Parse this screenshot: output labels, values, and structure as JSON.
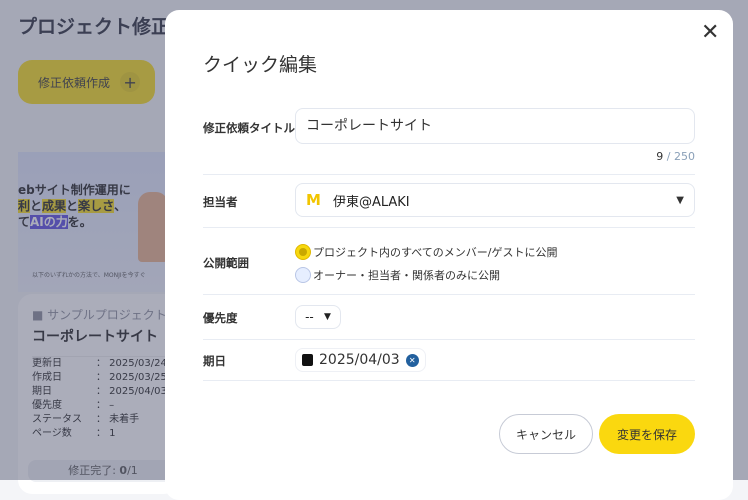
{
  "background": {
    "page_title": "プロジェクト修正",
    "create_button": "修正依頼作成",
    "thumbnail": {
      "line1": "ebサイト制作運用に",
      "line2a": "利",
      "line2b": "と",
      "line2c": "成果",
      "line2d": "と",
      "line2e": "楽しさ",
      "line2f": "、",
      "line3a": "て",
      "line3b": "AIの力",
      "line3c": "を。",
      "footer": "以下のいずれかの方法で、MONJIを今すぐ"
    },
    "card": {
      "project": "サンプルプロジェクト",
      "name": "コーポレートサイト",
      "rows": [
        {
          "k": "更新日",
          "v": "： 2025/03/24"
        },
        {
          "k": "作成日",
          "v": "： 2025/03/25"
        },
        {
          "k": "期日",
          "v": "： 2025/04/03"
        },
        {
          "k": "優先度",
          "v": "： –"
        },
        {
          "k": "ステータス",
          "v": "： 未着手"
        },
        {
          "k": "ページ数",
          "v": "： 1"
        }
      ],
      "progress_label": "修正完了: ",
      "progress_done": "0",
      "progress_total": "/1"
    }
  },
  "modal": {
    "title": "クイック編集",
    "title_label": "修正依頼タイトル",
    "title_value": "コーポレートサイト",
    "char_count": "9",
    "char_max": " / 250",
    "assignee_label": "担当者",
    "assignee_value": "伊東@ALAKI",
    "visibility_label": "公開範囲",
    "visibility_options": [
      "プロジェクト内のすべてのメンバー/ゲストに公開",
      "オーナー・担当者・関係者のみに公開"
    ],
    "priority_label": "優先度",
    "priority_value": "--",
    "due_label": "期日",
    "due_value": "2025/04/03",
    "cancel": "キャンセル",
    "save": "変更を保存"
  }
}
